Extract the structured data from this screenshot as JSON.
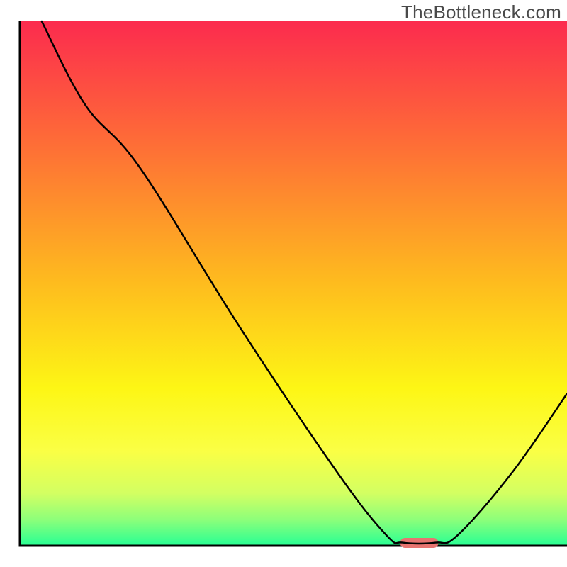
{
  "watermark": "TheBottleneck.com",
  "chart_data": {
    "type": "line",
    "title": "",
    "xlabel": "",
    "ylabel": "",
    "xlim": [
      0,
      100
    ],
    "ylim": [
      0,
      100
    ],
    "grid": false,
    "legend": false,
    "annotations": [],
    "tick_labels": {
      "x": [],
      "y": []
    },
    "background_gradient": {
      "stops": [
        {
          "pct": 0,
          "color": "#fc2b4e"
        },
        {
          "pct": 25,
          "color": "#fe7235"
        },
        {
          "pct": 50,
          "color": "#febc1e"
        },
        {
          "pct": 70,
          "color": "#fdf615"
        },
        {
          "pct": 82,
          "color": "#faff45"
        },
        {
          "pct": 90,
          "color": "#d3ff62"
        },
        {
          "pct": 95,
          "color": "#8dff7a"
        },
        {
          "pct": 100,
          "color": "#27ff94"
        }
      ]
    },
    "series": [
      {
        "name": "bottleneck-curve",
        "color": "#000000",
        "points": [
          {
            "x": 4.0,
            "y": 100.0
          },
          {
            "x": 12.0,
            "y": 84.0
          },
          {
            "x": 22.0,
            "y": 72.0
          },
          {
            "x": 40.0,
            "y": 42.0
          },
          {
            "x": 58.0,
            "y": 14.0
          },
          {
            "x": 67.0,
            "y": 2.0
          },
          {
            "x": 70.0,
            "y": 0.6
          },
          {
            "x": 76.0,
            "y": 0.6
          },
          {
            "x": 80.0,
            "y": 2.0
          },
          {
            "x": 90.0,
            "y": 14.0
          },
          {
            "x": 100.0,
            "y": 29.0
          }
        ]
      }
    ],
    "marker": {
      "name": "optimal-zone",
      "x_center": 73.0,
      "width": 7.0,
      "color": "#e77470"
    }
  }
}
